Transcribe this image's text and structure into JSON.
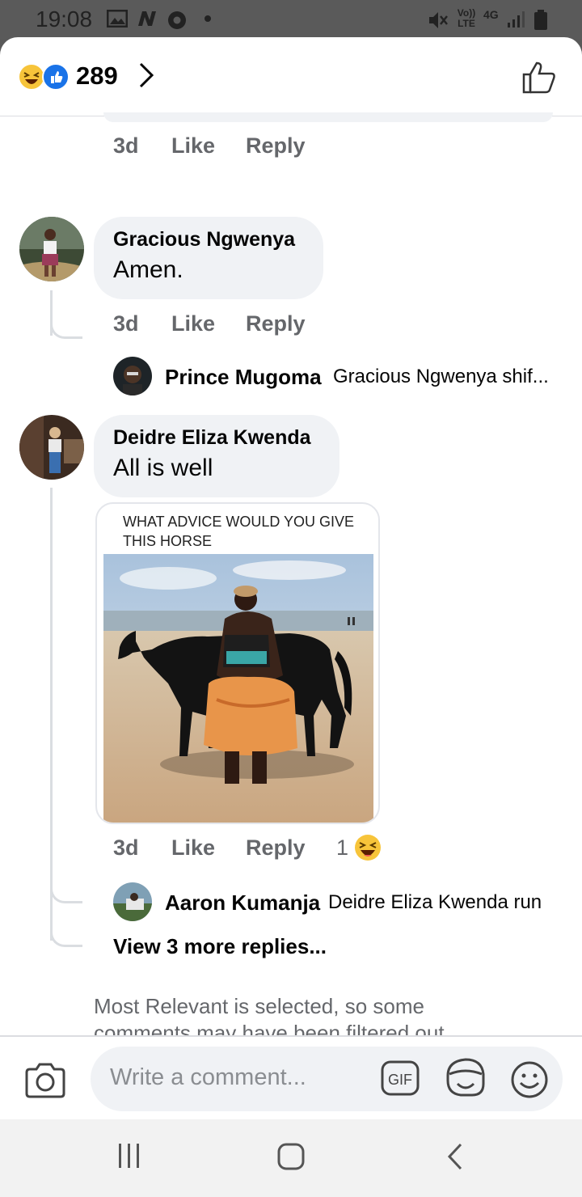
{
  "status_bar": {
    "time": "19:08",
    "icons": [
      "gallery-icon",
      "n-app-icon",
      "chrome-icon",
      "dot-icon",
      "mute-icon",
      "volte-icon",
      "4g-icon",
      "signal-icon",
      "battery-icon"
    ],
    "network": "4G",
    "volte": "Vo)) LTE"
  },
  "reactions_bar": {
    "count": "289",
    "icons": [
      "haha-emoji-icon",
      "like-reaction-icon",
      "chevron-right-icon"
    ],
    "like_icon": "thumbs-up-outline-icon"
  },
  "previous_comment_meta": {
    "time": "3d",
    "like": "Like",
    "reply": "Reply"
  },
  "comments": [
    {
      "author": "Gracious Ngwenya",
      "text": "Amen.",
      "time": "3d",
      "like": "Like",
      "reply": "Reply",
      "reply_preview": {
        "author": "Prince Mugoma",
        "text": "Gracious Ngwenya shif..."
      }
    },
    {
      "author": "Deidre Eliza Kwenda",
      "text": "All is well",
      "meme_caption": "WHAT ADVICE WOULD YOU GIVE THIS HORSE",
      "time": "3d",
      "like": "Like",
      "reply": "Reply",
      "reaction_count": "1",
      "reply_preview": {
        "author": "Aaron Kumanja",
        "text": "Deidre Eliza Kwenda run"
      },
      "view_more": "View 3 more replies..."
    }
  ],
  "filter_note": "Most Relevant is selected, so some comments may have been filtered out.",
  "composer": {
    "placeholder": "Write a comment...",
    "icons": [
      "camera-icon",
      "gif-icon",
      "sticker-icon",
      "emoji-icon"
    ]
  },
  "nav_bar": {
    "icons": [
      "recents-icon",
      "home-icon",
      "back-icon"
    ]
  },
  "colors": {
    "bubble": "#f0f2f5",
    "meta_text": "#65676b",
    "like_blue": "#1a73e8",
    "haha_yellow": "#f7c43a"
  }
}
